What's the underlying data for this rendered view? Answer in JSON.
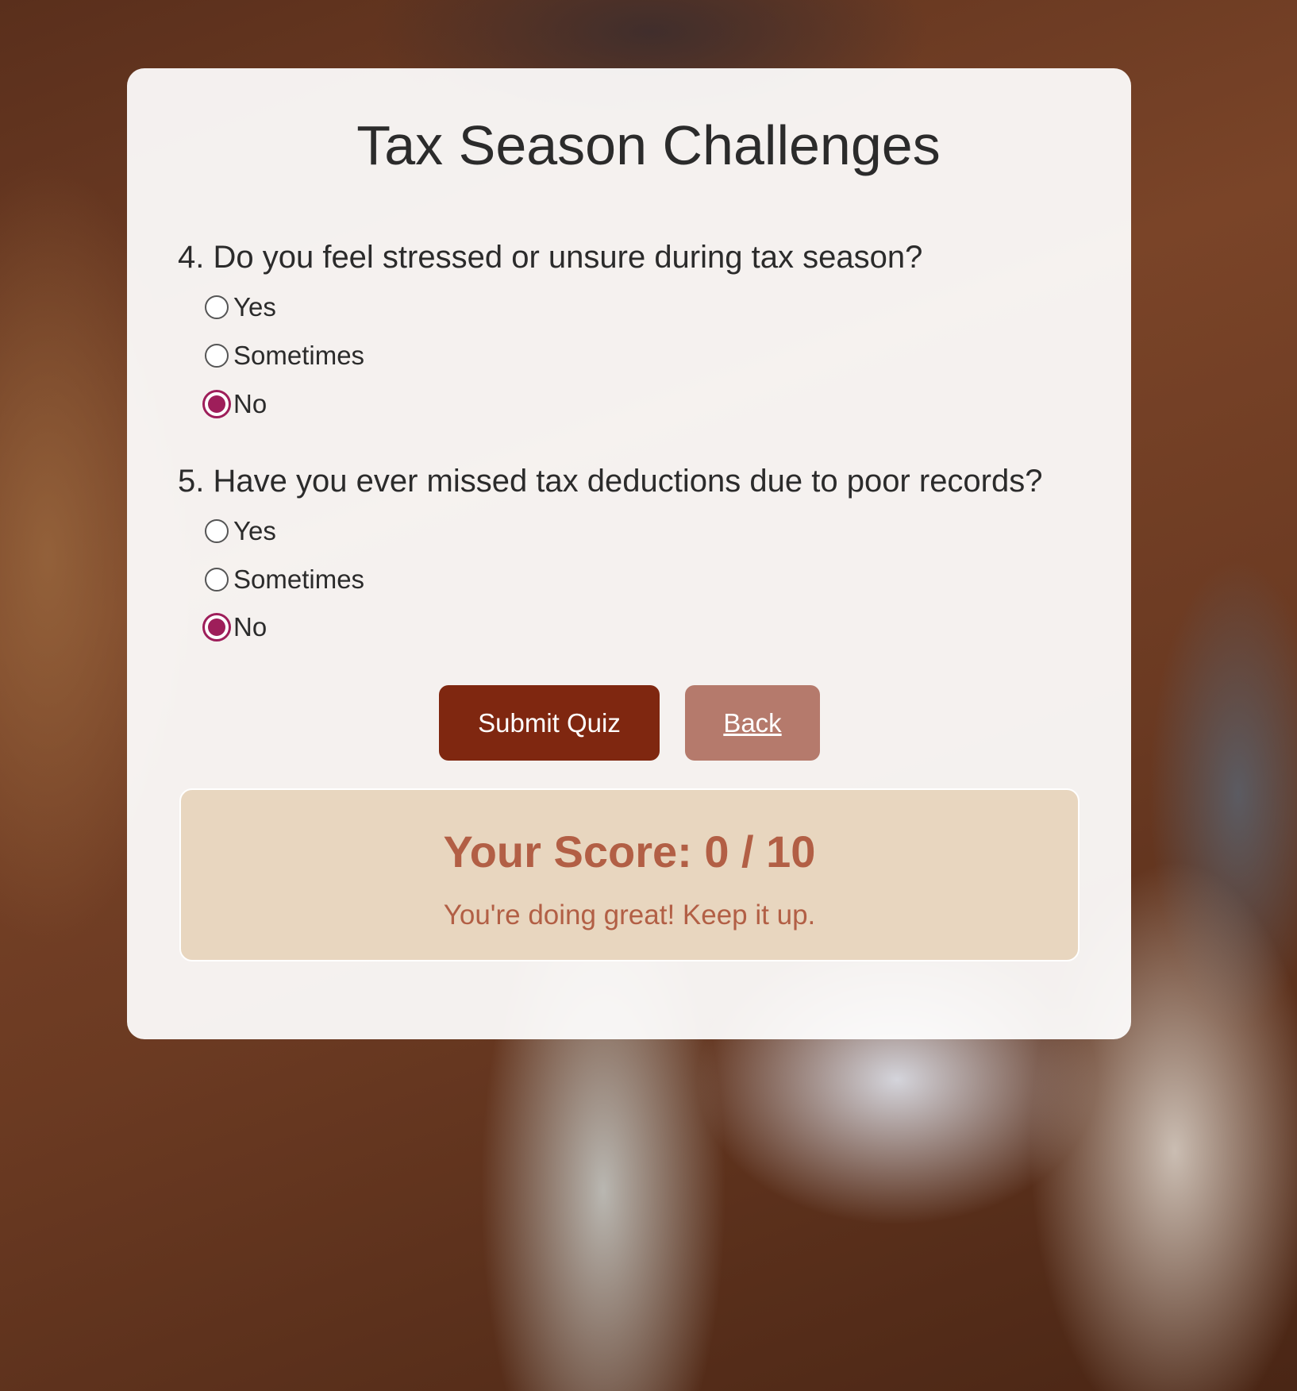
{
  "quiz": {
    "title": "Tax Season Challenges",
    "questions": [
      {
        "text": "4. Do you feel stressed or unsure during tax season?",
        "options": [
          "Yes",
          "Sometimes",
          "No"
        ],
        "selected": "No"
      },
      {
        "text": "5. Have you ever missed tax deductions due to poor records?",
        "options": [
          "Yes",
          "Sometimes",
          "No"
        ],
        "selected": "No"
      }
    ],
    "submit_label": "Submit Quiz",
    "back_label": "Back"
  },
  "result": {
    "score_text": "Your Score: 0 / 10",
    "message": "You're doing great! Keep it up."
  },
  "colors": {
    "accent_radio": "#9e1e5a",
    "submit_button": "#7f2710",
    "back_button": "#b57a6c",
    "score_box": "#e8d6bf",
    "score_text": "#b25f45"
  }
}
